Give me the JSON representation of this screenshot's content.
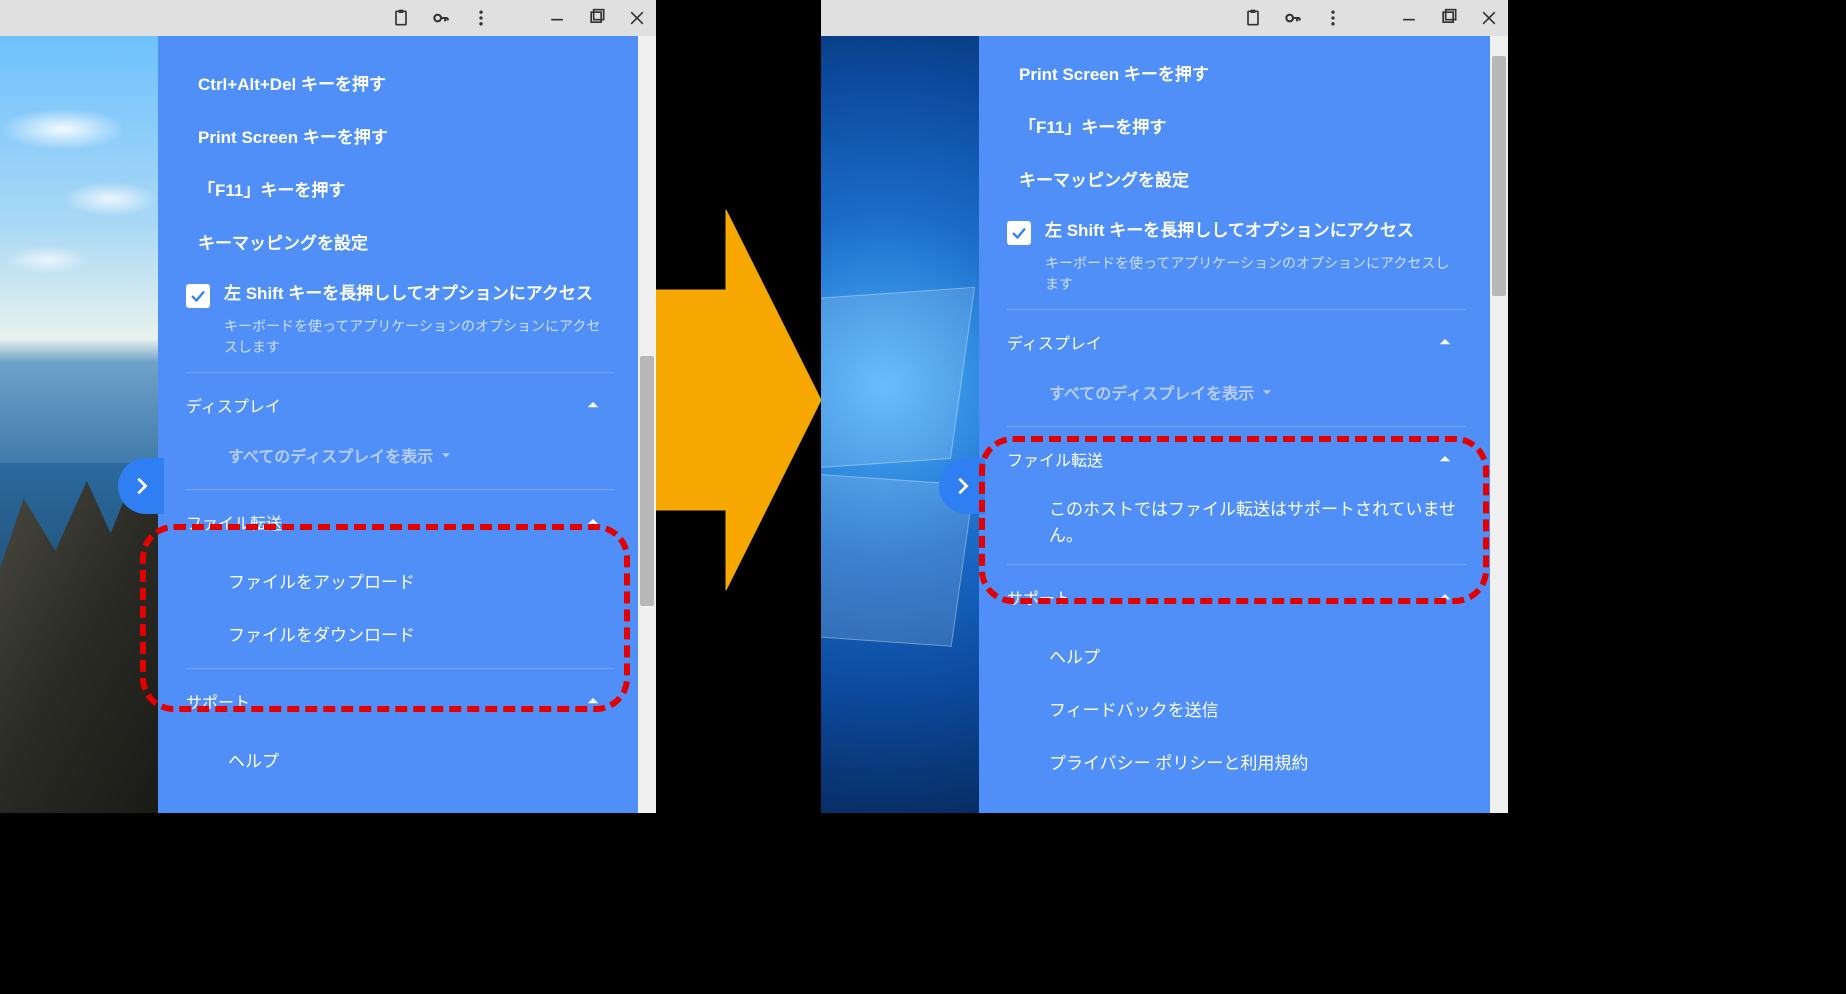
{
  "titlebar": {
    "icons": [
      "clipboard-icon",
      "key-icon",
      "more-vert-icon",
      "minimize-icon",
      "maximize-icon",
      "close-icon"
    ]
  },
  "left": {
    "items": {
      "ctrl_alt_del": "Ctrl+Alt+Del キーを押す",
      "print_screen": "Print Screen キーを押す",
      "f11": "「F11」キーを押す",
      "key_mapping": "キーマッピングを設定"
    },
    "shift_option": {
      "label": "左 Shift キーを長押ししてオプションにアクセス",
      "desc": "キーボードを使ってアプリケーションのオプションにアクセスします",
      "checked": true
    },
    "display": {
      "header": "ディスプレイ",
      "show_all": "すべてのディスプレイを表示"
    },
    "file_transfer": {
      "header": "ファイル転送",
      "upload": "ファイルをアップロード",
      "download": "ファイルをダウンロード"
    },
    "support": {
      "header": "サポート",
      "help": "ヘルプ"
    }
  },
  "right": {
    "items": {
      "print_screen": "Print Screen キーを押す",
      "f11": "「F11」キーを押す",
      "key_mapping": "キーマッピングを設定"
    },
    "shift_option": {
      "label": "左 Shift キーを長押ししてオプションにアクセス",
      "desc": "キーボードを使ってアプリケーションのオプションにアクセスします",
      "checked": true
    },
    "display": {
      "header": "ディスプレイ",
      "show_all": "すべてのディスプレイを表示"
    },
    "file_transfer": {
      "header": "ファイル転送",
      "unsupported": "このホストではファイル転送はサポートされていません。"
    },
    "support": {
      "header": "サポート",
      "help": "ヘルプ",
      "feedback": "フィードバックを送信",
      "privacy": "プライバシー ポリシーと利用規約"
    }
  }
}
